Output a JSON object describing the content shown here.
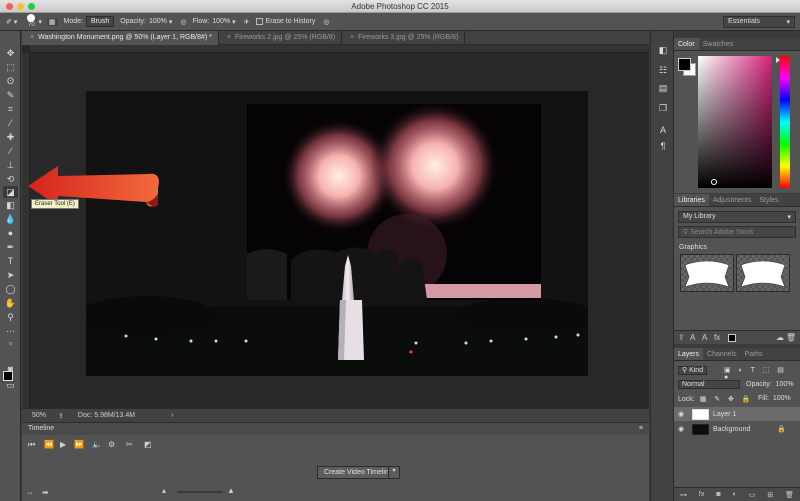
{
  "window": {
    "title": "Adobe Photoshop CC 2015"
  },
  "options_bar": {
    "brush_size": "70",
    "mode_label": "Mode:",
    "mode_value": "Brush",
    "opacity_label": "Opacity:",
    "opacity_value": "100%",
    "flow_label": "Flow:",
    "flow_value": "100%",
    "erase_history_label": "Erase to History",
    "workspace": "Essentials"
  },
  "tabs": [
    {
      "label": "Washington Monument.png @ 50% (Layer 1, RGB/8#) *"
    },
    {
      "label": "Fireworks 2.jpg @ 25% (RGB/8)"
    },
    {
      "label": "Fireworks 3.jpg @ 25% (RGB/8)"
    }
  ],
  "tooltip": "Eraser Tool (E)",
  "status": {
    "zoom": "50%",
    "doc": "Doc: 5.98M/13.4M"
  },
  "timeline": {
    "title": "Timeline",
    "create_button": "Create Video Timeline"
  },
  "color_panel": {
    "tabs": [
      "Color",
      "Swatches"
    ]
  },
  "libraries_panel": {
    "tabs": [
      "Libraries",
      "Adjustments",
      "Styles"
    ],
    "library": "My Library",
    "search_placeholder": "Search Adobe Stock",
    "section": "Graphics"
  },
  "layers_panel": {
    "tabs": [
      "Layers",
      "Channels",
      "Paths"
    ],
    "filter": "Kind",
    "blend_mode": "Normal",
    "opacity_label": "Opacity:",
    "opacity_value": "100%",
    "lock_label": "Lock:",
    "fill_label": "Fill:",
    "fill_value": "100%",
    "layers": [
      {
        "name": "Layer 1",
        "selected": true
      },
      {
        "name": "Background",
        "selected": false
      }
    ]
  }
}
